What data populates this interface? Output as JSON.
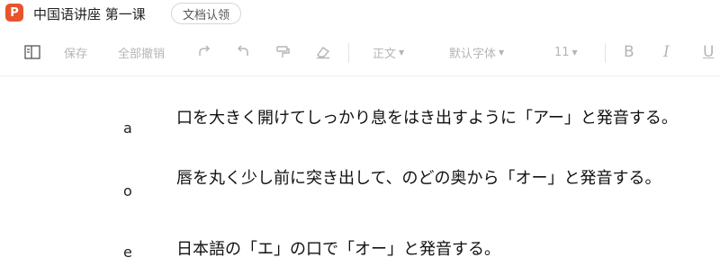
{
  "app": {
    "logo_letter": "P",
    "doc_title": "中国语讲座 第一课",
    "claim_button": "文档认领"
  },
  "toolbar": {
    "save": "保存",
    "cancel_all": "全部撤销",
    "style": "正文",
    "font": "默认字体",
    "size": "11",
    "bold": "B",
    "italic": "I",
    "underline": "U"
  },
  "entries": [
    {
      "label": "a",
      "text": "口を大きく開けてしっかり息をはき出すように「アー」と発音する。"
    },
    {
      "label": "o",
      "text": "唇を丸く少し前に突き出して、のどの奥から「オー」と発音する。"
    },
    {
      "label": "e",
      "text": "日本語の「エ」の口で「オー」と発音する。"
    }
  ]
}
